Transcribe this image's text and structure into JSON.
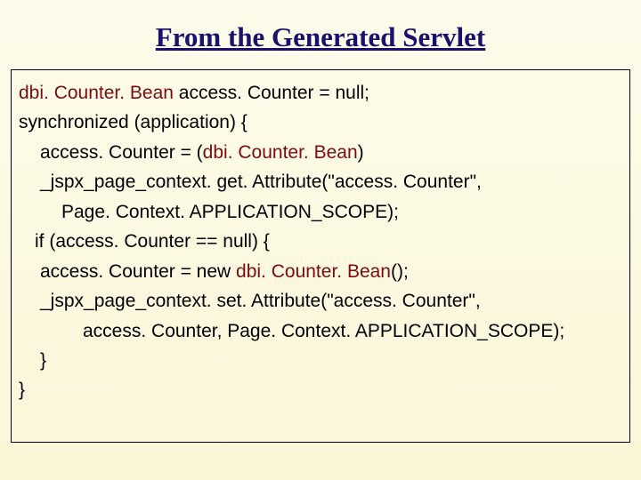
{
  "title": "From the Generated Servlet",
  "code": {
    "l1_kw": "dbi. Counter. Bean",
    "l1_rest": " access. Counter = null;",
    "l2": "synchronized (application) {",
    "l3a": "access. Counter = (",
    "l3_kw": "dbi. Counter. Bean",
    "l3b": ")",
    "l3c": "_jspx_page_context. get. Attribute(\"access. Counter\",",
    "l4": "Page. Context. APPLICATION_SCOPE);",
    "l5": "if (access. Counter == null) {",
    "l6a": "access. Counter = new ",
    "l6_kw": "dbi. Counter. Bean",
    "l6b": "();",
    "l7": "_jspx_page_context. set. Attribute(\"access. Counter\",",
    "l8": "access. Counter, Page. Context. APPLICATION_SCOPE);",
    "l9": "}",
    "l10": "}"
  }
}
